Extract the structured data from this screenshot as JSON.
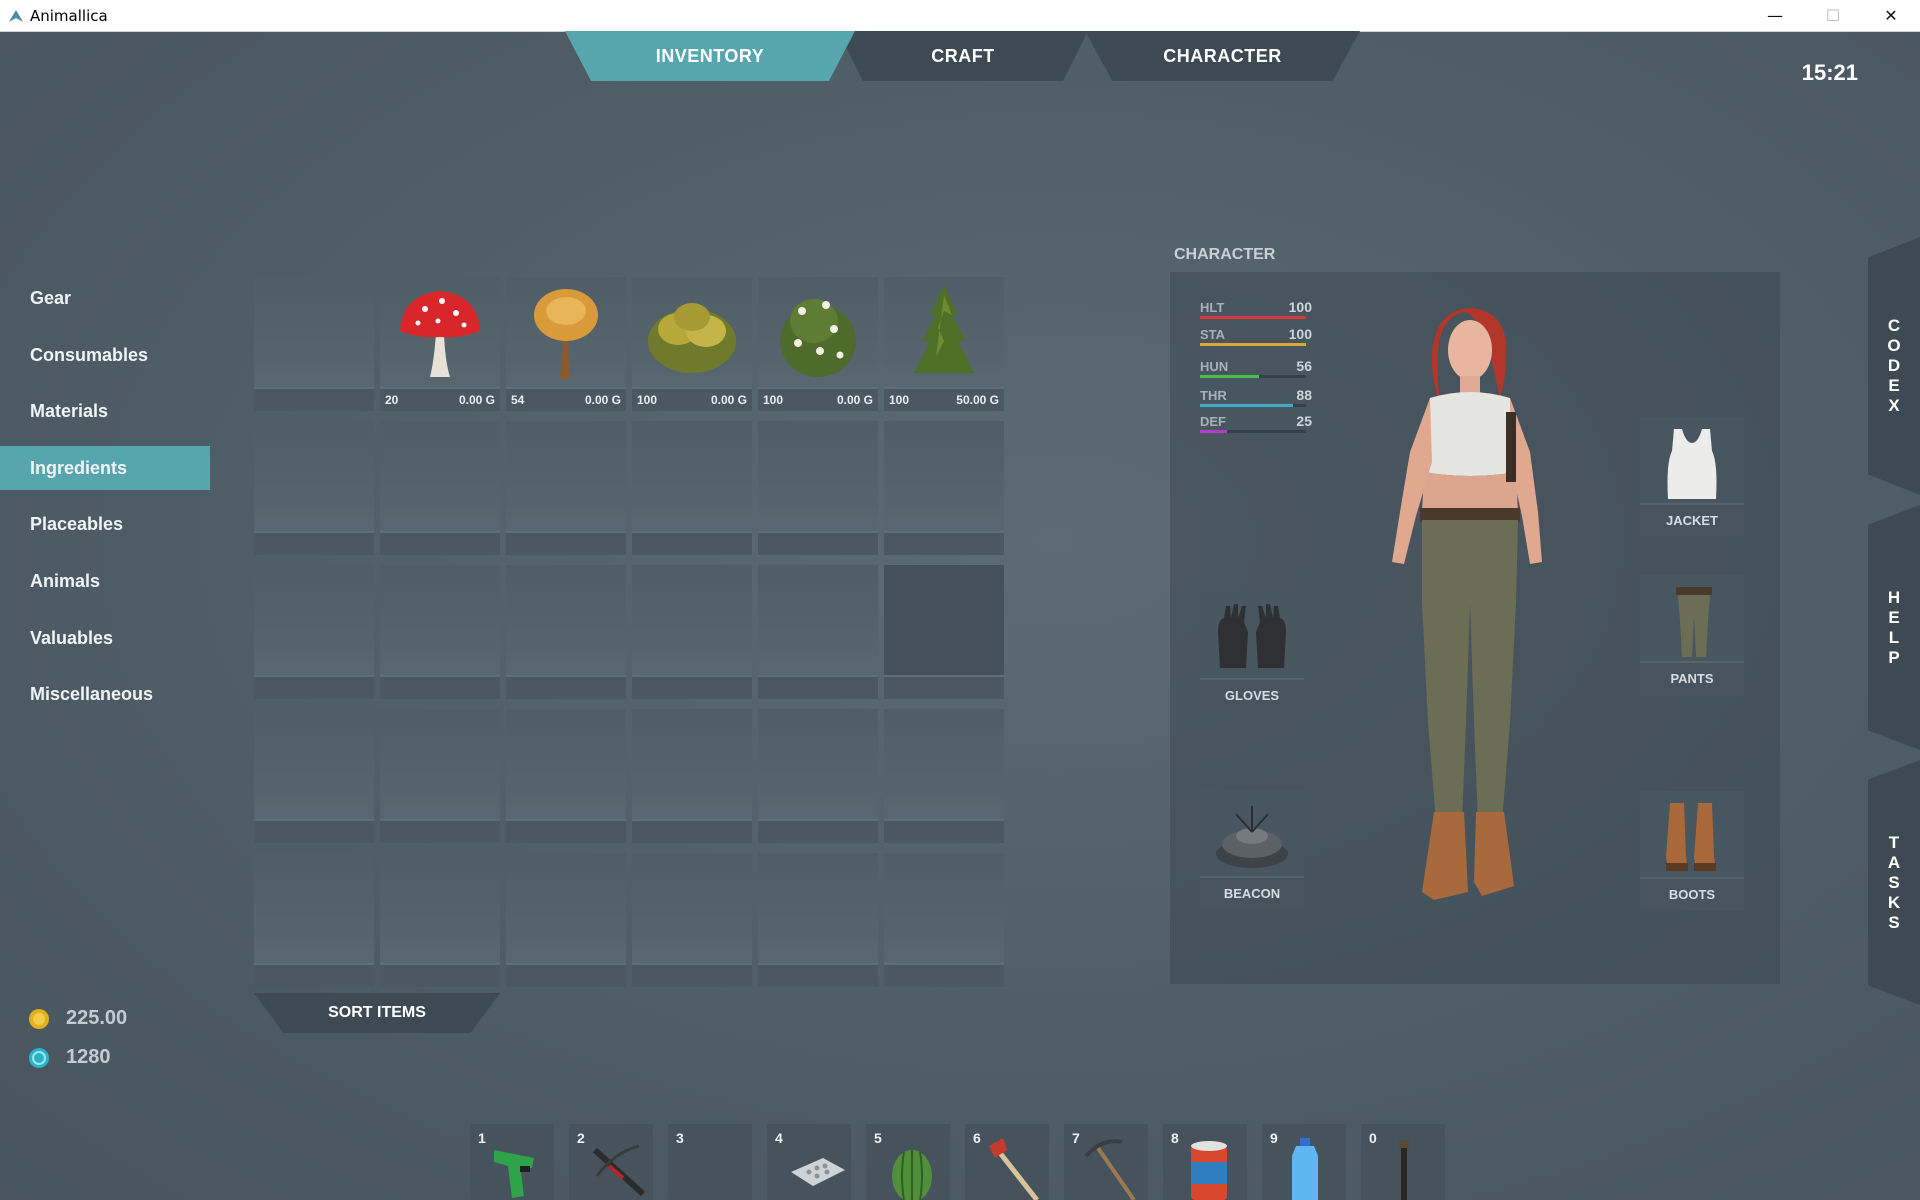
{
  "window": {
    "title": "Animallica",
    "controls": [
      "—",
      "☐",
      "✕"
    ]
  },
  "tabs": [
    {
      "label": "INVENTORY",
      "active": true
    },
    {
      "label": "CRAFT",
      "active": false
    },
    {
      "label": "CHARACTER",
      "active": false
    }
  ],
  "clock": "15:21",
  "categories": [
    {
      "label": "Gear",
      "active": false
    },
    {
      "label": "Consumables",
      "active": false
    },
    {
      "label": "Materials",
      "active": false
    },
    {
      "label": "Ingredients",
      "active": true
    },
    {
      "label": "Placeables",
      "active": false
    },
    {
      "label": "Animals",
      "active": false
    },
    {
      "label": "Valuables",
      "active": false
    },
    {
      "label": "Miscellaneous",
      "active": false
    }
  ],
  "inventory": {
    "items": [
      {
        "icon": "empty-slot",
        "count": "",
        "price": ""
      },
      {
        "icon": "red-mushroom-icon",
        "count": "20",
        "price": "0.00 G"
      },
      {
        "icon": "brown-mushroom-icon",
        "count": "54",
        "price": "0.00 G"
      },
      {
        "icon": "yellow-herb-icon",
        "count": "100",
        "price": "0.00 G"
      },
      {
        "icon": "white-flower-plant-icon",
        "count": "100",
        "price": "0.00 G"
      },
      {
        "icon": "fir-plant-icon",
        "count": "100",
        "price": "50.00 G"
      }
    ],
    "sort_label": "SORT ITEMS"
  },
  "currency": {
    "gold": "225.00",
    "gems": "1280"
  },
  "character": {
    "label": "CHARACTER",
    "stats": [
      {
        "name": "HLT",
        "value": "100",
        "level": 1.0,
        "color": "#d9383b"
      },
      {
        "name": "STA",
        "value": "100",
        "level": 1.0,
        "color": "#d8a93a"
      },
      {
        "name": "HUN",
        "value": "56",
        "level": 0.56,
        "color": "#4bbd4e"
      },
      {
        "name": "THR",
        "value": "88",
        "level": 0.88,
        "color": "#3fa9c6"
      },
      {
        "name": "DEF",
        "value": "25",
        "level": 0.25,
        "color": "#b13fc4"
      }
    ],
    "equipment": {
      "jacket": "JACKET",
      "gloves": "GLOVES",
      "pants": "PANTS",
      "beacon": "BEACON",
      "boots": "BOOTS"
    }
  },
  "side_tabs": [
    {
      "label": "CODEX",
      "letters": [
        "C",
        "O",
        "D",
        "E",
        "X"
      ]
    },
    {
      "label": "HELP",
      "letters": [
        "H",
        "E",
        "L",
        "P"
      ]
    },
    {
      "label": "TASKS",
      "letters": [
        "T",
        "A",
        "S",
        "K",
        "S"
      ]
    }
  ],
  "hotbar": [
    {
      "num": "1",
      "icon": "green-pistol-icon"
    },
    {
      "num": "2",
      "icon": "crossbow-icon"
    },
    {
      "num": "3",
      "icon": "empty-slot"
    },
    {
      "num": "4",
      "icon": "pill-pack-icon"
    },
    {
      "num": "5",
      "icon": "watermelon-icon"
    },
    {
      "num": "6",
      "icon": "axe-icon"
    },
    {
      "num": "7",
      "icon": "pickaxe-icon"
    },
    {
      "num": "8",
      "icon": "canned-food-icon"
    },
    {
      "num": "9",
      "icon": "water-bottle-icon"
    },
    {
      "num": "0",
      "icon": "torch-icon"
    }
  ]
}
